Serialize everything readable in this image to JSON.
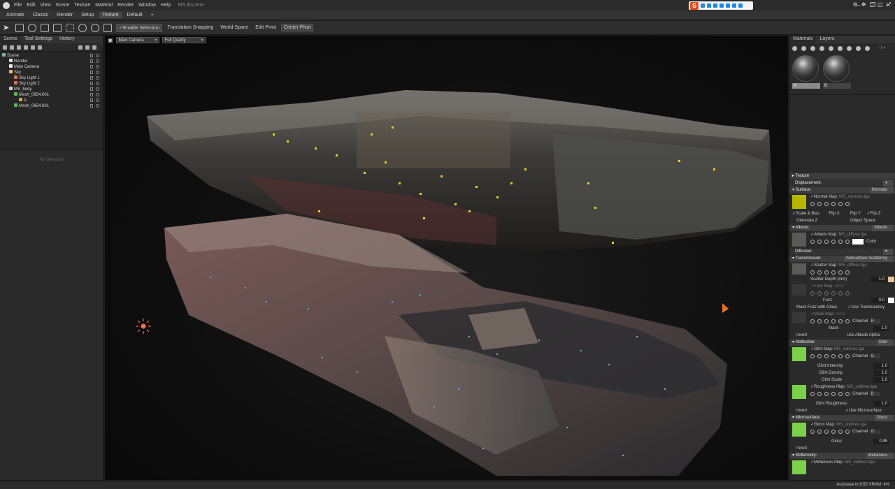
{
  "app": {
    "filename": "MS.tbscene",
    "menu": [
      "File",
      "Edit",
      "View",
      "Scene",
      "Texture",
      "Material",
      "Render",
      "Window",
      "Help"
    ]
  },
  "modes": [
    "Animate",
    "Classic",
    "Render",
    "Setup",
    "Texture",
    "Default",
    "+"
  ],
  "active_mode": "Texture",
  "toolbar": {
    "enable_selection": "✓Enable Selection",
    "translation_snapping": "Translation Snapping",
    "world_space": "World Space",
    "edit_pivot": "Edit Pivot",
    "center_pivot": "Center Pivot"
  },
  "left_panel": {
    "tabs": [
      "Scene",
      "Tool Settings",
      "History"
    ],
    "tree": [
      {
        "label": "Scene",
        "depth": 0
      },
      {
        "label": "Render",
        "depth": 1
      },
      {
        "label": "Main Camera",
        "depth": 1
      },
      {
        "label": "Sky",
        "depth": 1
      },
      {
        "label": "Sky Light 1",
        "depth": 2
      },
      {
        "label": "Sky Light 2",
        "depth": 2
      },
      {
        "label": "MS_body",
        "depth": 1
      },
      {
        "label": "Mesh_0654.001",
        "depth": 2
      },
      {
        "label": "A",
        "depth": 3
      },
      {
        "label": "Mesh_0654.001",
        "depth": 2
      }
    ],
    "no_selection": "No Selection"
  },
  "viewport": {
    "camera": "Main Camera",
    "quality": "Full Quality"
  },
  "right_panel": {
    "tabs": [
      "Materials",
      "Layers"
    ],
    "materials": [
      "A",
      "B"
    ],
    "zoom": "- / +",
    "texture_section": "Texture",
    "displacement": "Displacement:",
    "surface": {
      "label": "Surface:",
      "value": "Normals"
    },
    "normal_map": {
      "label": "Normal Map:",
      "file": "MS_normals.tga"
    },
    "normal_opts": [
      "Scale & Bias",
      "Flip X",
      "Flip Y",
      "Flip Z",
      "Generate Z",
      "Object Space"
    ],
    "albedo": {
      "label": "Albedo:",
      "value": "Albedo"
    },
    "albedo_map": {
      "label": "Albedo Map:",
      "file": "MS_diffuse.tga",
      "color": "Color"
    },
    "diffusion": "Diffusion:",
    "transmission": {
      "label": "Transmission:",
      "value": "Subsurface Scattering"
    },
    "scatter_map": {
      "label": "Scatter Map:",
      "file": "MS_diffuse.tga"
    },
    "scatter_depth": {
      "label": "Scatter Depth (mm)",
      "value": "1.0"
    },
    "fuzz_map": {
      "label": "Fuzz Map:",
      "file": "none"
    },
    "fuzz": {
      "label": "Fuzz",
      "value": "0.0"
    },
    "mask_fuzz": "Mask Fuzz with Gloss",
    "use_translucency": "Use Translucency",
    "mask_map": {
      "label": "Mask Map:",
      "file": "none",
      "channel": "Channel",
      "channel_value": "R"
    },
    "mask": {
      "label": "Mask",
      "value": "1.0"
    },
    "invert": "Invert",
    "use_albedo_alpha": "Use Albedo Alpha",
    "reflection": {
      "label": "Reflection:",
      "value": "Glint"
    },
    "glint_map": {
      "label": "Glint Map:",
      "file": "MS_outlines.tga",
      "channel": "Channel",
      "channel_value": "G"
    },
    "glint_intensity": {
      "label": "Glint Intensity",
      "value": "1.0"
    },
    "glint_density": {
      "label": "Glint Density",
      "value": "1.0"
    },
    "glint_scale": {
      "label": "Glint Scale",
      "value": "1.0"
    },
    "roughness_map": {
      "label": "Roughness Map:",
      "file": "MS_outlines.tga",
      "channel": "Channel",
      "channel_value": "B"
    },
    "glint_roughness": {
      "label": "Glint Roughness",
      "value": "1.0"
    },
    "use_microsurface": "Use Microsurface",
    "microsurface": {
      "label": "Microsurface:",
      "value": "Gloss"
    },
    "gloss_map": {
      "label": "Gloss Map:",
      "file": "MS_outlines.tga",
      "channel": "Channel",
      "channel_value": "G"
    },
    "gloss": {
      "label": "Gloss",
      "value": "0.95"
    },
    "reflectivity": {
      "label": "Reflectivity:",
      "value": "Metalness"
    },
    "metalness_map": {
      "label": "Metalness Map:",
      "file": "MS_outlines.tga"
    }
  },
  "status": {
    "text": "Autosave in 8:52  VRAM: 4%"
  },
  "colors": {
    "normal_swatch": "#b8b800",
    "map_swatch": "#7bd04a",
    "scatter_swatch": "#f0c090",
    "accent": "#3d3d3d"
  }
}
